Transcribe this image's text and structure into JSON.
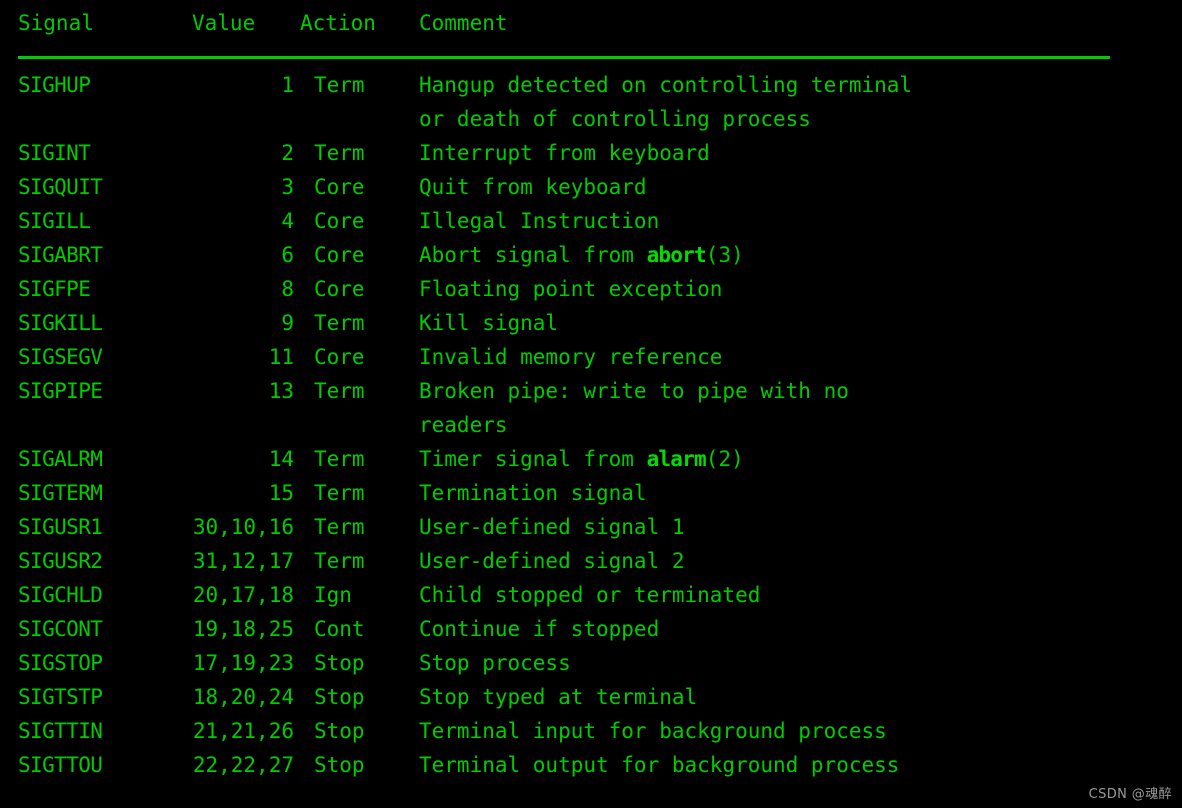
{
  "terminal": {
    "background_color": "#000000",
    "text_color": "#00cc00",
    "bold_color": "#00dd00",
    "watermark": "CSDN @魂醉"
  },
  "table": {
    "headers": {
      "signal": "Signal",
      "value": "Value",
      "action": "Action",
      "comment": "Comment"
    },
    "rows": [
      {
        "signal": "SIGHUP",
        "value": "1",
        "action": "Term",
        "comment_line1": "Hangup detected on controlling terminal",
        "comment_line2": "or death of controlling process"
      },
      {
        "signal": "SIGINT",
        "value": "2",
        "action": "Term",
        "comment_line1": "Interrupt from keyboard",
        "comment_line2": ""
      },
      {
        "signal": "SIGQUIT",
        "value": "3",
        "action": "Core",
        "comment_line1": "Quit from keyboard",
        "comment_line2": ""
      },
      {
        "signal": "SIGILL",
        "value": "4",
        "action": "Core",
        "comment_line1": "Illegal Instruction",
        "comment_line2": ""
      },
      {
        "signal": "SIGABRT",
        "value": "6",
        "action": "Core",
        "comment_prefix": "Abort signal from ",
        "comment_bold": "abort",
        "comment_suffix": "(3)",
        "comment_line2": ""
      },
      {
        "signal": "SIGFPE",
        "value": "8",
        "action": "Core",
        "comment_line1": "Floating point exception",
        "comment_line2": ""
      },
      {
        "signal": "SIGKILL",
        "value": "9",
        "action": "Term",
        "comment_line1": "Kill signal",
        "comment_line2": ""
      },
      {
        "signal": "SIGSEGV",
        "value": "11",
        "action": "Core",
        "comment_line1": "Invalid memory reference",
        "comment_line2": ""
      },
      {
        "signal": "SIGPIPE",
        "value": "13",
        "action": "Term",
        "comment_line1": "Broken pipe: write to pipe with no",
        "comment_line2": "readers"
      },
      {
        "signal": "SIGALRM",
        "value": "14",
        "action": "Term",
        "comment_prefix": "Timer signal from ",
        "comment_bold": "alarm",
        "comment_suffix": "(2)",
        "comment_line2": ""
      },
      {
        "signal": "SIGTERM",
        "value": "15",
        "action": "Term",
        "comment_line1": "Termination signal",
        "comment_line2": ""
      },
      {
        "signal": "SIGUSR1",
        "value": "30,10,16",
        "action": "Term",
        "comment_line1": "User-defined signal 1",
        "comment_line2": ""
      },
      {
        "signal": "SIGUSR2",
        "value": "31,12,17",
        "action": "Term",
        "comment_line1": "User-defined signal 2",
        "comment_line2": ""
      },
      {
        "signal": "SIGCHLD",
        "value": "20,17,18",
        "action": "Ign",
        "comment_line1": "Child stopped or terminated",
        "comment_line2": ""
      },
      {
        "signal": "SIGCONT",
        "value": "19,18,25",
        "action": "Cont",
        "comment_line1": "Continue if stopped",
        "comment_line2": ""
      },
      {
        "signal": "SIGSTOP",
        "value": "17,19,23",
        "action": "Stop",
        "comment_line1": "Stop process",
        "comment_line2": ""
      },
      {
        "signal": "SIGTSTP",
        "value": "18,20,24",
        "action": "Stop",
        "comment_line1": "Stop typed at terminal",
        "comment_line2": ""
      },
      {
        "signal": "SIGTTIN",
        "value": "21,21,26",
        "action": "Stop",
        "comment_line1": "Terminal input for background process",
        "comment_line2": ""
      },
      {
        "signal": "SIGTTOU",
        "value": "22,22,27",
        "action": "Stop",
        "comment_line1": "Terminal output for background process",
        "comment_line2": ""
      }
    ]
  }
}
